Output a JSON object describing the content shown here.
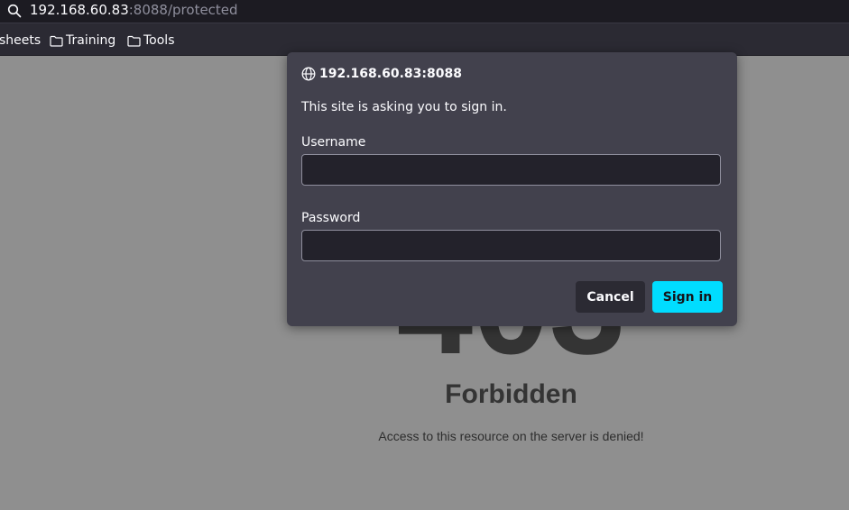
{
  "browser": {
    "url_host": "192.168.60.83",
    "url_rest": ":8088/protected",
    "search_icon": "search-icon",
    "bookmarks": [
      {
        "label": "sheets",
        "icon": ""
      },
      {
        "label": "Training",
        "icon": "folder-icon"
      },
      {
        "label": "Tools",
        "icon": "folder-icon"
      }
    ]
  },
  "page": {
    "code": "403",
    "title": "Forbidden",
    "message": "Access to this resource on the server is denied!"
  },
  "dialog": {
    "host": "192.168.60.83:8088",
    "host_icon": "globe-icon",
    "message": "This site is asking you to sign in.",
    "username_label": "Username",
    "username_value": "",
    "password_label": "Password",
    "password_value": "",
    "cancel_label": "Cancel",
    "signin_label": "Sign in"
  },
  "colors": {
    "accent": "#00ddff",
    "dialog_bg": "#42414d",
    "toolbar_bg": "#2b2a33",
    "page_bg": "#8f8f8f"
  }
}
